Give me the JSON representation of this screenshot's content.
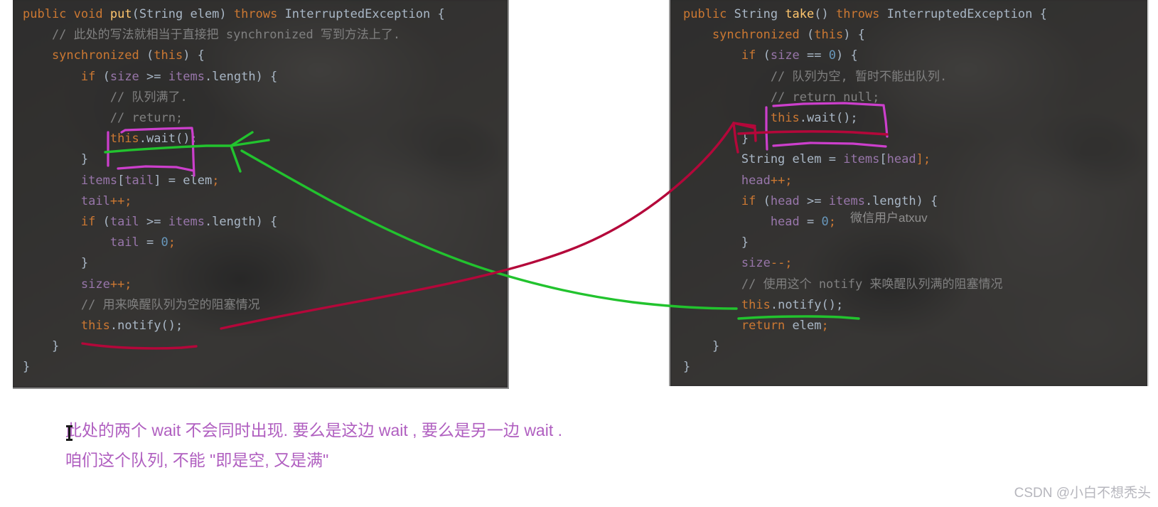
{
  "colors": {
    "page_background": "#ffffff",
    "code_background": "#2b2b2b",
    "keyword": "#cc7832",
    "method": "#ffc66d",
    "field": "#9876aa",
    "number": "#6897bb",
    "comment": "#808080",
    "plain_text": "#a9b7c6",
    "annotation_green": "#22c32e",
    "annotation_red": "#b4073a",
    "annotation_magenta": "#cc3fcc",
    "note_text": "#b05fc0",
    "csdn_watermark": "#b6b6bd"
  },
  "left_panel": {
    "name": "put-method-code",
    "lines": [
      [
        {
          "t": "public ",
          "c": "k"
        },
        {
          "t": "void ",
          "c": "k"
        },
        {
          "t": "put",
          "c": "m"
        },
        {
          "t": "(",
          "c": "p"
        },
        {
          "t": "String ",
          "c": "t"
        },
        {
          "t": "elem",
          "c": "t"
        },
        {
          "t": ") ",
          "c": "p"
        },
        {
          "t": "throws ",
          "c": "k"
        },
        {
          "t": "InterruptedException ",
          "c": "t"
        },
        {
          "t": "{",
          "c": "p"
        }
      ],
      [
        {
          "t": "    // 此处的写法就相当于直接把 synchronized 写到方法上了.",
          "c": "c"
        }
      ],
      [
        {
          "t": "    synchronized ",
          "c": "k"
        },
        {
          "t": "(",
          "c": "p"
        },
        {
          "t": "this",
          "c": "k"
        },
        {
          "t": ") {",
          "c": "p"
        }
      ],
      [
        {
          "t": "        if ",
          "c": "k"
        },
        {
          "t": "(",
          "c": "p"
        },
        {
          "t": "size ",
          "c": "f"
        },
        {
          "t": ">= ",
          "c": "o"
        },
        {
          "t": "items",
          "c": "f"
        },
        {
          "t": ".length) {",
          "c": "p"
        }
      ],
      [
        {
          "t": "            // 队列满了.",
          "c": "c"
        }
      ],
      [
        {
          "t": "            // return;",
          "c": "c"
        }
      ],
      [
        {
          "t": "            ",
          "c": "p"
        },
        {
          "t": "this",
          "c": "k"
        },
        {
          "t": ".wait();",
          "c": "p"
        }
      ],
      [
        {
          "t": "        }",
          "c": "p"
        }
      ],
      [
        {
          "t": "        items",
          "c": "f"
        },
        {
          "t": "[",
          "c": "p"
        },
        {
          "t": "tail",
          "c": "f"
        },
        {
          "t": "] ",
          "c": "p"
        },
        {
          "t": "= ",
          "c": "o"
        },
        {
          "t": "elem",
          "c": "t"
        },
        {
          "t": ";",
          "c": "k"
        }
      ],
      [
        {
          "t": "        tail",
          "c": "f"
        },
        {
          "t": "++;",
          "c": "k"
        }
      ],
      [
        {
          "t": "        if ",
          "c": "k"
        },
        {
          "t": "(",
          "c": "p"
        },
        {
          "t": "tail ",
          "c": "f"
        },
        {
          "t": ">= ",
          "c": "o"
        },
        {
          "t": "items",
          "c": "f"
        },
        {
          "t": ".length) {",
          "c": "p"
        }
      ],
      [
        {
          "t": "            tail ",
          "c": "f"
        },
        {
          "t": "= ",
          "c": "o"
        },
        {
          "t": "0",
          "c": "n"
        },
        {
          "t": ";",
          "c": "k"
        }
      ],
      [
        {
          "t": "        }",
          "c": "p"
        }
      ],
      [
        {
          "t": "        size",
          "c": "f"
        },
        {
          "t": "++;",
          "c": "k"
        }
      ],
      [
        {
          "t": "        // 用来唤醒队列为空的阻塞情况",
          "c": "c"
        }
      ],
      [
        {
          "t": "        ",
          "c": "p"
        },
        {
          "t": "this",
          "c": "k"
        },
        {
          "t": ".notify();",
          "c": "p"
        }
      ],
      [
        {
          "t": "    }",
          "c": "p"
        }
      ],
      [
        {
          "t": "}",
          "c": "p"
        }
      ]
    ]
  },
  "right_panel": {
    "name": "take-method-code",
    "lines": [
      [
        {
          "t": "public ",
          "c": "k"
        },
        {
          "t": "String ",
          "c": "t"
        },
        {
          "t": "take",
          "c": "m"
        },
        {
          "t": "() ",
          "c": "p"
        },
        {
          "t": "throws ",
          "c": "k"
        },
        {
          "t": "InterruptedException ",
          "c": "t"
        },
        {
          "t": "{",
          "c": "p"
        }
      ],
      [
        {
          "t": "    synchronized ",
          "c": "k"
        },
        {
          "t": "(",
          "c": "p"
        },
        {
          "t": "this",
          "c": "k"
        },
        {
          "t": ") {",
          "c": "p"
        }
      ],
      [
        {
          "t": "        if ",
          "c": "k"
        },
        {
          "t": "(",
          "c": "p"
        },
        {
          "t": "size ",
          "c": "f"
        },
        {
          "t": "== ",
          "c": "o"
        },
        {
          "t": "0",
          "c": "n"
        },
        {
          "t": ") {",
          "c": "p"
        }
      ],
      [
        {
          "t": "            // 队列为空, 暂时不能出队列.",
          "c": "c"
        }
      ],
      [
        {
          "t": "            // return null;",
          "c": "c"
        }
      ],
      [
        {
          "t": "            ",
          "c": "p"
        },
        {
          "t": "this",
          "c": "k"
        },
        {
          "t": ".wait();",
          "c": "p"
        }
      ],
      [
        {
          "t": "        }",
          "c": "p"
        }
      ],
      [
        {
          "t": "        String ",
          "c": "t"
        },
        {
          "t": "elem ",
          "c": "t"
        },
        {
          "t": "= ",
          "c": "o"
        },
        {
          "t": "items",
          "c": "f"
        },
        {
          "t": "[",
          "c": "p"
        },
        {
          "t": "head",
          "c": "f"
        },
        {
          "t": "];",
          "c": "k"
        }
      ],
      [
        {
          "t": "        head",
          "c": "f"
        },
        {
          "t": "++;",
          "c": "k"
        }
      ],
      [
        {
          "t": "        if ",
          "c": "k"
        },
        {
          "t": "(",
          "c": "p"
        },
        {
          "t": "head ",
          "c": "f"
        },
        {
          "t": ">= ",
          "c": "o"
        },
        {
          "t": "items",
          "c": "f"
        },
        {
          "t": ".length) {",
          "c": "p"
        }
      ],
      [
        {
          "t": "            head ",
          "c": "f"
        },
        {
          "t": "= ",
          "c": "o"
        },
        {
          "t": "0",
          "c": "n"
        },
        {
          "t": ";",
          "c": "k"
        }
      ],
      [
        {
          "t": "        }",
          "c": "p"
        }
      ],
      [
        {
          "t": "        size",
          "c": "f"
        },
        {
          "t": "--;",
          "c": "k"
        }
      ],
      [
        {
          "t": "        // 使用这个 notify 来唤醒队列满的阻塞情况",
          "c": "c"
        }
      ],
      [
        {
          "t": "        ",
          "c": "p"
        },
        {
          "t": "this",
          "c": "k"
        },
        {
          "t": ".notify();",
          "c": "p"
        }
      ],
      [
        {
          "t": "        return ",
          "c": "k"
        },
        {
          "t": "elem",
          "c": "t"
        },
        {
          "t": ";",
          "c": "k"
        }
      ],
      [
        {
          "t": "    }",
          "c": "p"
        }
      ],
      [
        {
          "t": "}",
          "c": "p"
        }
      ]
    ]
  },
  "wechat_watermark": "微信用户atxuv",
  "csdn_watermark": "CSDN @小白不想秃头",
  "note": {
    "line1": "此处的两个 wait 不会同时出现. 要么是这边 wait , 要么是另一边 wait .",
    "line2": "咱们这个队列, 不能 \"即是空, 又是满\""
  },
  "annotations": [
    {
      "name": "magenta-box-left-wait",
      "color": "#cc3fcc",
      "shape": "rectangle-highlight",
      "target": "left this.wait();"
    },
    {
      "name": "magenta-box-right-wait",
      "color": "#cc3fcc",
      "shape": "rectangle-highlight",
      "target": "right this.wait();"
    },
    {
      "name": "green-arrow-right-notify-to-left-wait",
      "color": "#22c32e",
      "shape": "curved-arrow",
      "from": "right this.notify();",
      "to": "left this.wait();"
    },
    {
      "name": "red-arrow-left-notify-to-right-wait",
      "color": "#b4073a",
      "shape": "curved-arrow",
      "from": "left this.notify();",
      "to": "right this.wait();"
    },
    {
      "name": "green-underline-right-notify",
      "color": "#22c32e",
      "shape": "underline",
      "target": "right this.notify();"
    },
    {
      "name": "green-underline-left-wait",
      "color": "#22c32e",
      "shape": "underline",
      "target": "left this.wait();"
    },
    {
      "name": "red-underline-left-notify",
      "color": "#b4073a",
      "shape": "underline",
      "target": "left this.notify();"
    },
    {
      "name": "red-underline-right-wait",
      "color": "#b4073a",
      "shape": "underline",
      "target": "right this.wait();"
    }
  ]
}
